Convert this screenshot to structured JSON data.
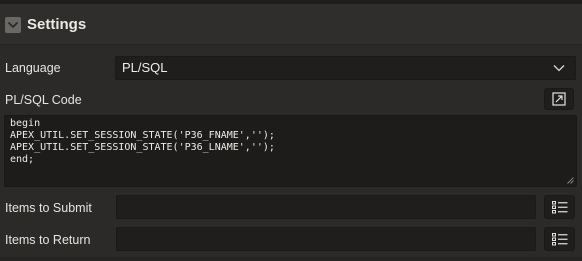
{
  "section": {
    "title": "Settings",
    "toggle_icon": "chevron-down-icon"
  },
  "language": {
    "label": "Language",
    "value": "PL/SQL",
    "dropdown_icon": "chevron-down-icon"
  },
  "code": {
    "label": "PL/SQL Code",
    "expand_icon": "expand-icon",
    "lines": [
      "begin",
      "APEX_UTIL.SET_SESSION_STATE('P36_FNAME','');",
      "APEX_UTIL.SET_SESSION_STATE('P36_LNAME','');",
      "end;"
    ]
  },
  "items_to_submit": {
    "label": "Items to Submit",
    "value": "",
    "picker_icon": "list-icon"
  },
  "items_to_return": {
    "label": "Items to Return",
    "value": "",
    "picker_icon": "list-icon"
  },
  "colors": {
    "background": "#2b2a28",
    "field_background": "#1f1e1c",
    "text": "#e6e4e0"
  }
}
